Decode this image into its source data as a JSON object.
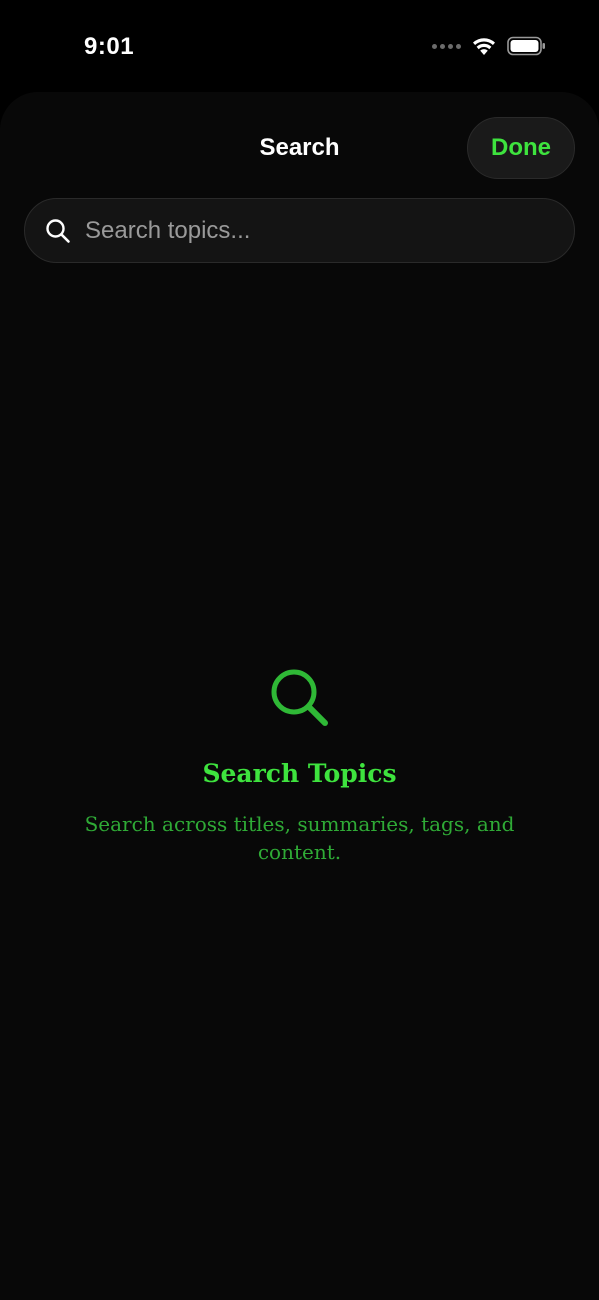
{
  "status_bar": {
    "time": "9:01",
    "icons": [
      "signal-dots-icon",
      "wifi-icon",
      "battery-icon"
    ]
  },
  "sheet": {
    "title": "Search",
    "done_label": "Done"
  },
  "search": {
    "placeholder": "Search topics...",
    "value": ""
  },
  "empty_state": {
    "icon": "magnifying-glass-icon",
    "title": "Search Topics",
    "description": "Search across titles, summaries, tags, and content."
  },
  "colors": {
    "accent": "#3ee33e",
    "accent_dim": "#2faa36",
    "background": "#080808"
  }
}
